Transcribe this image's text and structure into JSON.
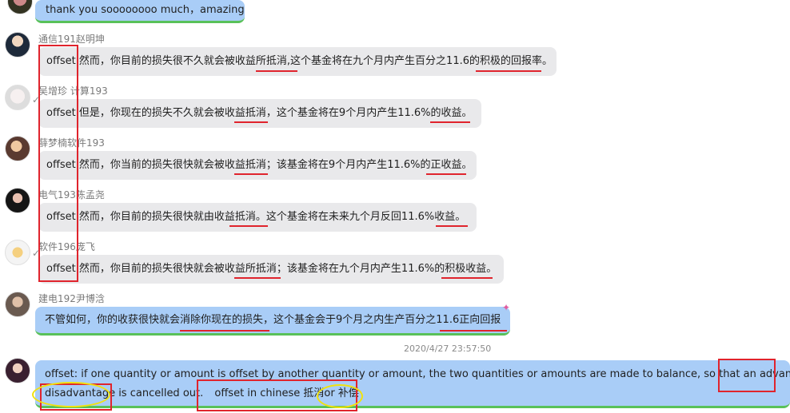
{
  "messages": [
    {
      "name": "",
      "text": "thank you soooooooo much，amazing"
    },
    {
      "name": "通信191赵明坤",
      "keyword": "offset",
      "text": "然而，你目前的损失很不久就会被收益所抵消,这个基金将在九个月内产生百分之11.6的积极的回报率。"
    },
    {
      "name": "吴增珍 计算193",
      "keyword": "offset",
      "text": "但是，你现在的损失不久就会被收益抵消，这个基金将在9个月内产生11.6%的收益。"
    },
    {
      "name": "薛梦楠软件193",
      "keyword": "offset",
      "text": "然而，你当前的损失很快就会被收益抵消；该基金将在9个月内产生11.6%的正收益。"
    },
    {
      "name": "电气193陈孟尧",
      "keyword": "offset",
      "text": "然而，你目前的损失很快就由收益抵消。这个基金将在未来九个月反回11.6%收益。"
    },
    {
      "name": "软件196庞飞",
      "keyword": "offset",
      "text": "然而，你目前的损失很快就会被收益所抵消；该基金将在九个月内产生11.6%的积极收益。"
    },
    {
      "name": "建电192尹博浛",
      "text": "不管如何，你的收获很快就会消除你现在的损失，这个基金会于9个月之内生产百分之11.6正向回报"
    }
  ],
  "timestamp": "2020/4/27 23:57:50",
  "definition": {
    "line1": "offset: if one quantity or amount is offset by another quantity or amount, the two quantities or amounts are made to balance, so that an advantage or",
    "line2a": "disadvantage is cancelled out.",
    "line2b": "offset in chinese 抵消or 补偿"
  },
  "colors": {
    "accent_red": "#e0242d",
    "highlight_yellow": "#f1e10e",
    "self_bubble": "#a9cdf7",
    "other_bubble": "#e9e9eb"
  }
}
